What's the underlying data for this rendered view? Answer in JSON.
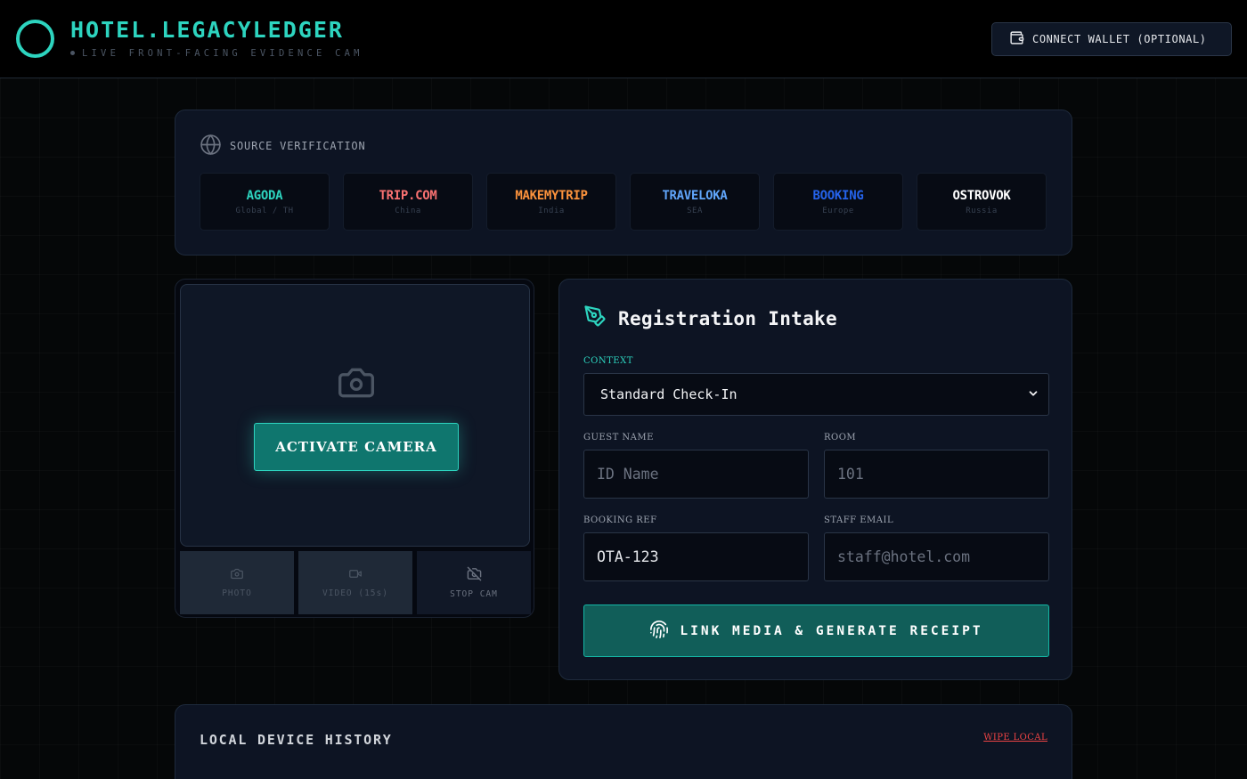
{
  "header": {
    "brand_title": "HOTEL.LEGACYLEDGER",
    "brand_subtitle": "LIVE FRONT-FACING EVIDENCE CAM",
    "wallet_button": "CONNECT WALLET (OPTIONAL)",
    "accent_color": "#2dd4bf"
  },
  "source": {
    "heading": "SOURCE VERIFICATION",
    "icon": "globe-icon",
    "otas": [
      {
        "name": "AGODA",
        "region": "Global / TH",
        "color": "#2dd4bf"
      },
      {
        "name": "TRIP.COM",
        "region": "China",
        "color": "#f87171"
      },
      {
        "name": "MAKEMYTRIP",
        "region": "India",
        "color": "#fb923c"
      },
      {
        "name": "TRAVELOKA",
        "region": "SEA",
        "color": "#60a5fa"
      },
      {
        "name": "BOOKING",
        "region": "Europe",
        "color": "#2563eb"
      },
      {
        "name": "OSTROVOK",
        "region": "Russia",
        "color": "#ffffff"
      }
    ]
  },
  "camera": {
    "activate_label": "ACTIVATE CAMERA",
    "controls": {
      "photo": "PHOTO",
      "video": "VIDEO (15s)",
      "stop": "STOP CAM"
    }
  },
  "registration": {
    "title": "Registration Intake",
    "context_label": "CONTEXT",
    "context_value": "Standard Check-In",
    "guest_name_label": "GUEST NAME",
    "guest_name_placeholder": "ID Name",
    "room_label": "ROOM",
    "room_placeholder": "101",
    "booking_ref_label": "BOOKING REF",
    "booking_ref_value": "OTA-123",
    "staff_email_label": "STAFF EMAIL",
    "staff_email_placeholder": "staff@hotel.com",
    "generate_button": "LINK MEDIA & GENERATE RECEIPT"
  },
  "history": {
    "title": "LOCAL DEVICE HISTORY",
    "wipe_label": "WIPE LOCAL"
  }
}
